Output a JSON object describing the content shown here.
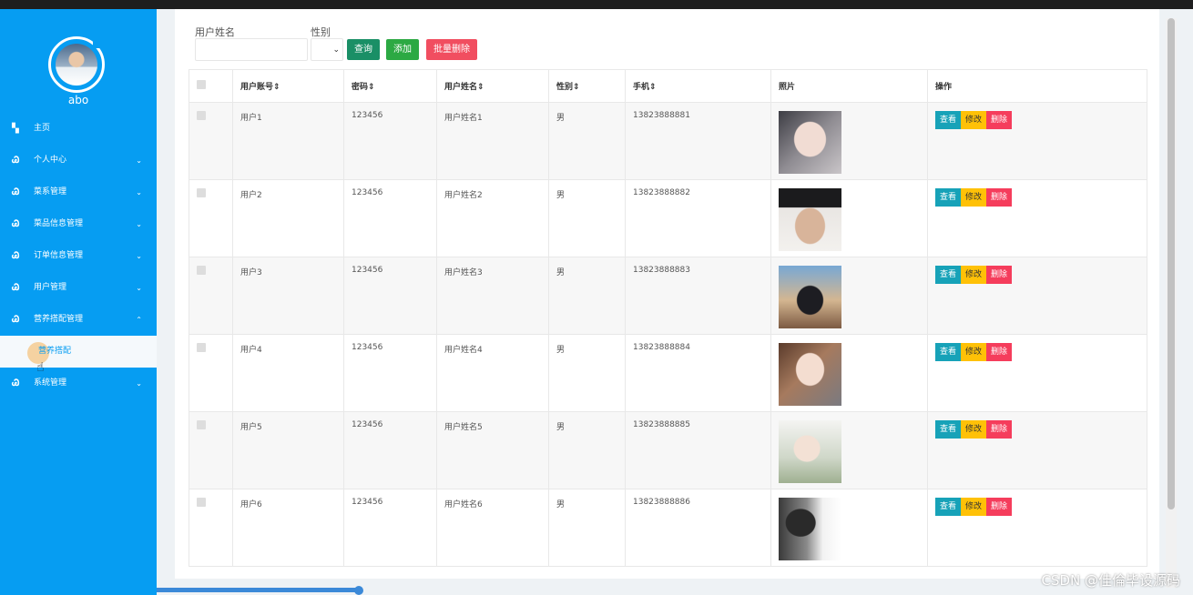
{
  "sidebar": {
    "username": "abo",
    "items": [
      {
        "label": "主页",
        "icon": "dashboard-icon"
      },
      {
        "label": "个人中心",
        "icon": "stethoscope-icon"
      },
      {
        "label": "菜系管理",
        "icon": "stethoscope-icon"
      },
      {
        "label": "菜品信息管理",
        "icon": "stethoscope-icon"
      },
      {
        "label": "订单信息管理",
        "icon": "stethoscope-icon"
      },
      {
        "label": "用户管理",
        "icon": "stethoscope-icon"
      },
      {
        "label": "营养搭配管理",
        "icon": "stethoscope-icon"
      }
    ],
    "sub_item": "营养搭配",
    "last_item": "系统管理"
  },
  "search": {
    "name_label": "用户姓名",
    "name_value": "",
    "gender_label": "性别",
    "gender_value": "",
    "query_label": "查询",
    "add_label": "添加",
    "batch_delete_label": "批量删除"
  },
  "table": {
    "headers": [
      "用户账号",
      "密码",
      "用户姓名",
      "性别",
      "手机",
      "照片",
      "操作"
    ],
    "rows": [
      {
        "account": "用户1",
        "password": "123456",
        "name": "用户姓名1",
        "gender": "男",
        "phone": "13823888881"
      },
      {
        "account": "用户2",
        "password": "123456",
        "name": "用户姓名2",
        "gender": "男",
        "phone": "13823888882"
      },
      {
        "account": "用户3",
        "password": "123456",
        "name": "用户姓名3",
        "gender": "男",
        "phone": "13823888883"
      },
      {
        "account": "用户4",
        "password": "123456",
        "name": "用户姓名4",
        "gender": "男",
        "phone": "13823888884"
      },
      {
        "account": "用户5",
        "password": "123456",
        "name": "用户姓名5",
        "gender": "男",
        "phone": "13823888885"
      },
      {
        "account": "用户6",
        "password": "123456",
        "name": "用户姓名6",
        "gender": "男",
        "phone": "13823888886"
      }
    ],
    "actions": {
      "view": "查看",
      "edit": "修改",
      "delete": "删除"
    }
  },
  "watermark": "CSDN @佳倫毕设源码",
  "colors": {
    "sidebar": "#069df2",
    "view": "#17a2b8",
    "edit": "#ffc107",
    "delete": "#f53d5c"
  }
}
